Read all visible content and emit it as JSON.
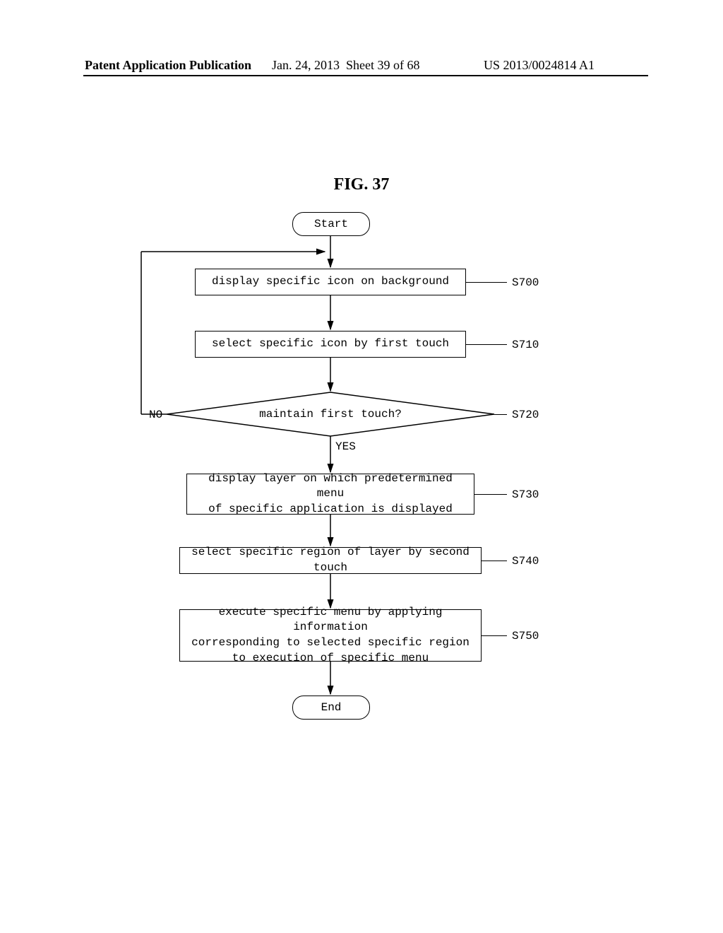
{
  "header": {
    "left": "Patent Application Publication",
    "date": "Jan. 24, 2013",
    "sheet": "Sheet 39 of 68",
    "pubno": "US 2013/0024814 A1"
  },
  "figure_title": "FIG. 37",
  "terminals": {
    "start": "Start",
    "end": "End"
  },
  "steps": {
    "s700": {
      "id": "S700",
      "text": "display specific icon on background"
    },
    "s710": {
      "id": "S710",
      "text": "select specific icon by first touch"
    },
    "s720": {
      "id": "S720",
      "text": "maintain first touch?"
    },
    "s730": {
      "id": "S730",
      "text": "display layer on which predetermined menu\nof specific application is displayed"
    },
    "s740": {
      "id": "S740",
      "text": "select specific region of layer by second touch"
    },
    "s750": {
      "id": "S750",
      "text": "execute specific menu by applying information\ncorresponding to selected specific region\nto execution of specific menu"
    }
  },
  "branches": {
    "no": "NO",
    "yes": "YES"
  },
  "chart_data": {
    "type": "flowchart",
    "nodes": [
      {
        "id": "start",
        "kind": "terminal",
        "label": "Start"
      },
      {
        "id": "S700",
        "kind": "process",
        "label": "display specific icon on background"
      },
      {
        "id": "S710",
        "kind": "process",
        "label": "select specific icon by first touch"
      },
      {
        "id": "S720",
        "kind": "decision",
        "label": "maintain first touch?"
      },
      {
        "id": "S730",
        "kind": "process",
        "label": "display layer on which predetermined menu of specific application is displayed"
      },
      {
        "id": "S740",
        "kind": "process",
        "label": "select specific region of layer by second touch"
      },
      {
        "id": "S750",
        "kind": "process",
        "label": "execute specific menu by applying information corresponding to selected specific region to execution of specific menu"
      },
      {
        "id": "end",
        "kind": "terminal",
        "label": "End"
      }
    ],
    "edges": [
      {
        "from": "start",
        "to": "S700"
      },
      {
        "from": "S700",
        "to": "S710"
      },
      {
        "from": "S710",
        "to": "S720"
      },
      {
        "from": "S720",
        "to": "S730",
        "label": "YES"
      },
      {
        "from": "S720",
        "to": "S700",
        "label": "NO"
      },
      {
        "from": "S730",
        "to": "S740"
      },
      {
        "from": "S740",
        "to": "S750"
      },
      {
        "from": "S750",
        "to": "end"
      }
    ]
  }
}
